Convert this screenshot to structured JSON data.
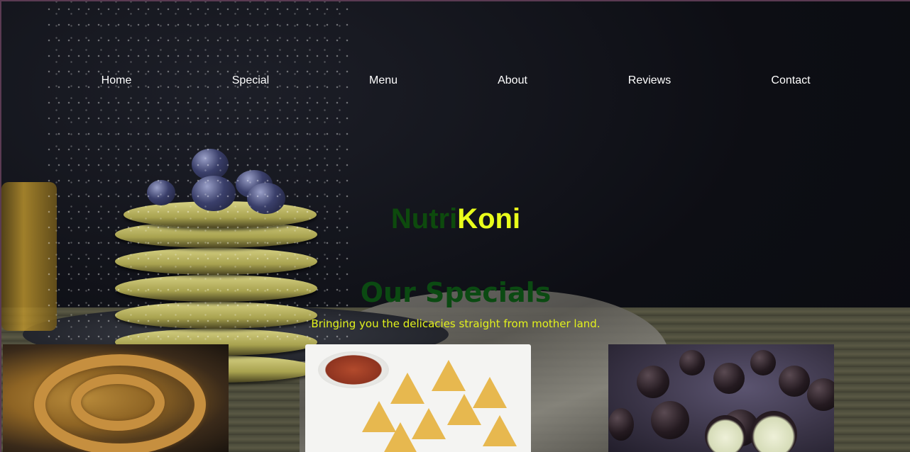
{
  "nav": {
    "items": [
      {
        "label": "Home"
      },
      {
        "label": "Special"
      },
      {
        "label": "Menu"
      },
      {
        "label": "About"
      },
      {
        "label": "Reviews"
      },
      {
        "label": "Contact"
      }
    ]
  },
  "brand": {
    "part1": "Nutri",
    "part2": "Koni"
  },
  "specials": {
    "title": "Our Specials",
    "subtitle": "Bringing you the delicacies straight from mother land."
  },
  "colors": {
    "brand_green": "#0d4a0d",
    "brand_yellow": "#e9ff1b",
    "nav_text": "#ffffff",
    "background": "#0c0d12"
  }
}
